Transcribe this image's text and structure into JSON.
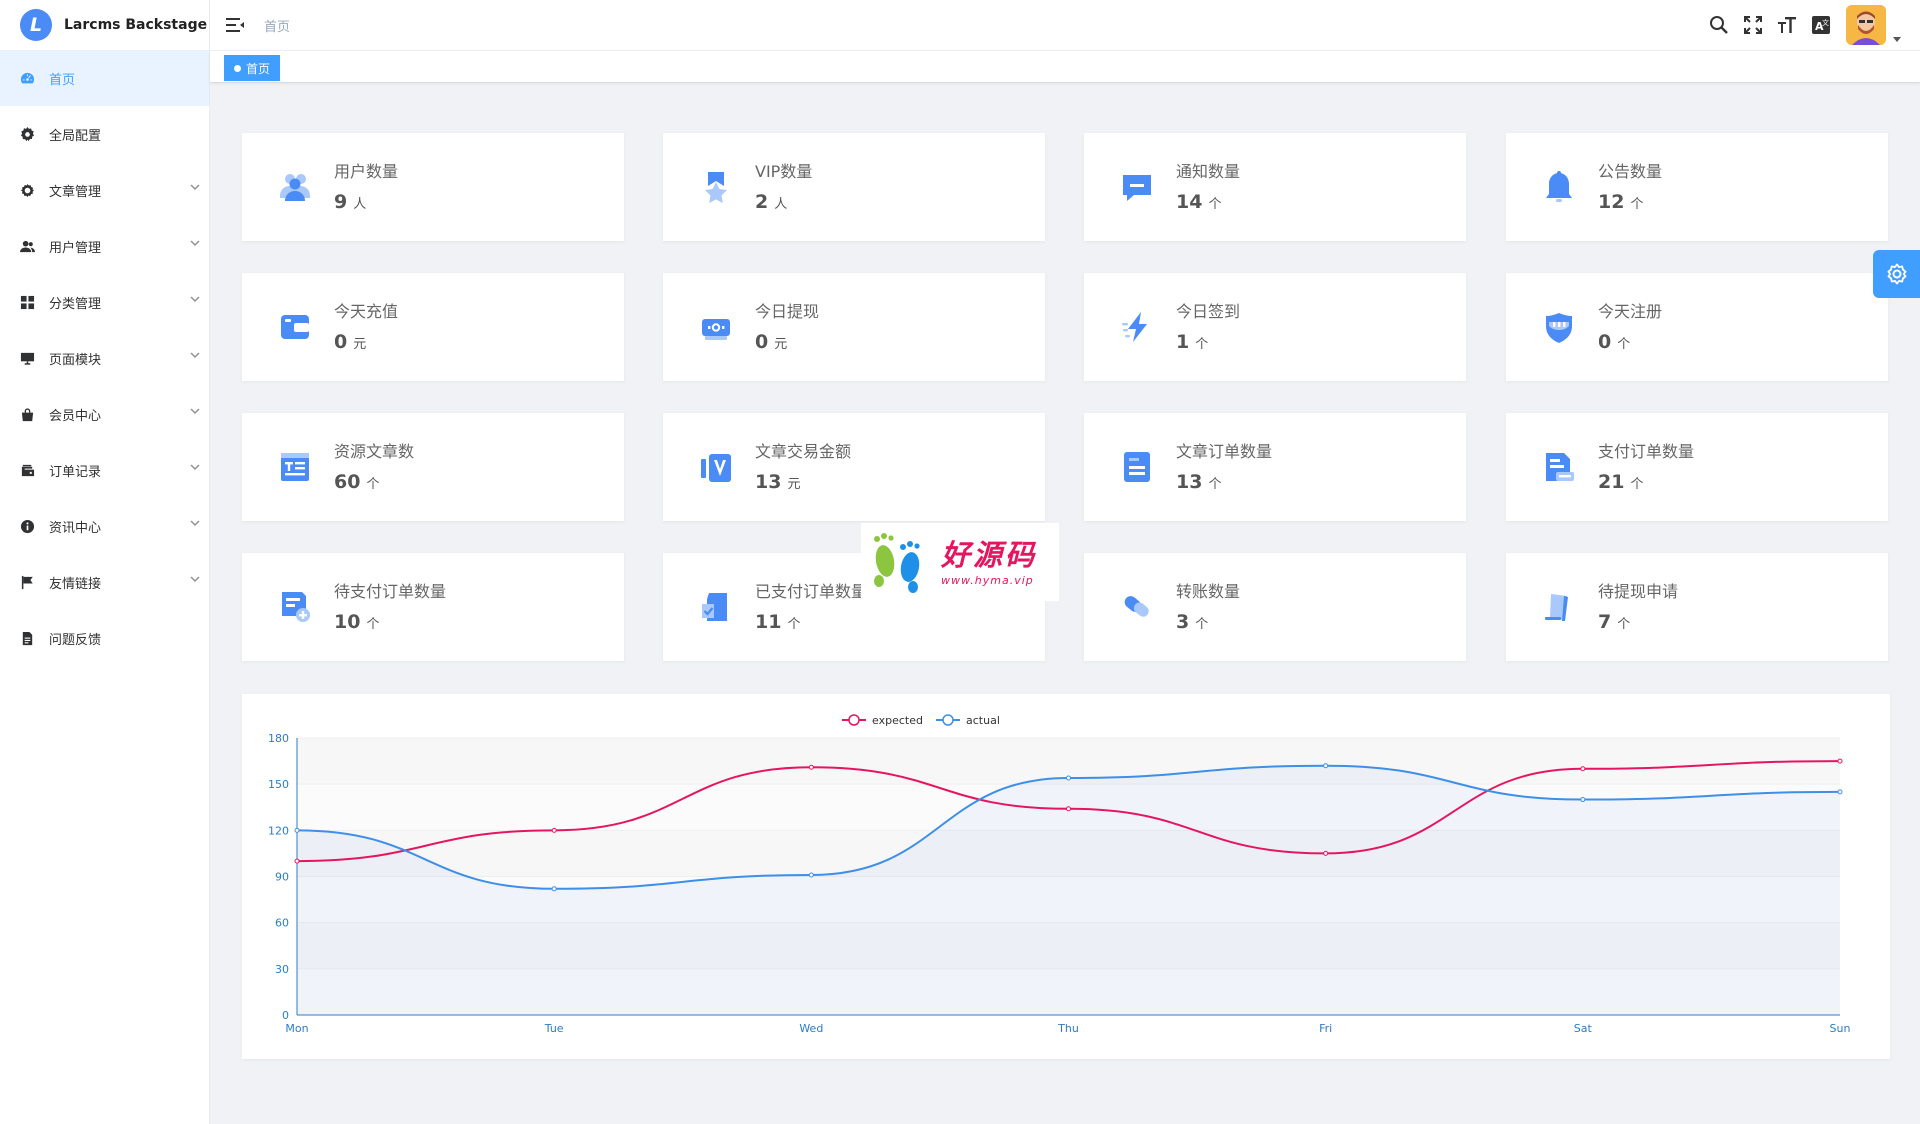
{
  "app": {
    "title": "Larcms Backstage",
    "logo_letter": "L"
  },
  "header": {
    "breadcrumb": "首页"
  },
  "tags": [
    {
      "label": "首页",
      "active": true
    }
  ],
  "sidebar": {
    "items": [
      {
        "label": "首页",
        "icon": "dashboard-icon",
        "active": true,
        "expandable": false
      },
      {
        "label": "全局配置",
        "icon": "gear-icon",
        "active": false,
        "expandable": false
      },
      {
        "label": "文章管理",
        "icon": "settings-ring-icon",
        "active": false,
        "expandable": true
      },
      {
        "label": "用户管理",
        "icon": "users-icon",
        "active": false,
        "expandable": true
      },
      {
        "label": "分类管理",
        "icon": "grid-icon",
        "active": false,
        "expandable": true
      },
      {
        "label": "页面模块",
        "icon": "monitor-icon",
        "active": false,
        "expandable": true
      },
      {
        "label": "会员中心",
        "icon": "bag-icon",
        "active": false,
        "expandable": true
      },
      {
        "label": "订单记录",
        "icon": "wallet-icon",
        "active": false,
        "expandable": true
      },
      {
        "label": "资讯中心",
        "icon": "info-icon",
        "active": false,
        "expandable": true
      },
      {
        "label": "友情链接",
        "icon": "flag-icon",
        "active": false,
        "expandable": true
      },
      {
        "label": "问题反馈",
        "icon": "document-icon",
        "active": false,
        "expandable": false
      }
    ]
  },
  "stats": [
    {
      "title": "用户数量",
      "value": "9",
      "unit": "人",
      "icon": "users-icon"
    },
    {
      "title": "VIP数量",
      "value": "2",
      "unit": "人",
      "icon": "vip-star-icon"
    },
    {
      "title": "通知数量",
      "value": "14",
      "unit": "个",
      "icon": "message-icon"
    },
    {
      "title": "公告数量",
      "value": "12",
      "unit": "个",
      "icon": "bell-icon"
    },
    {
      "title": "今天充值",
      "value": "0",
      "unit": "元",
      "icon": "wallet-icon"
    },
    {
      "title": "今日提现",
      "value": "0",
      "unit": "元",
      "icon": "cash-icon"
    },
    {
      "title": "今日签到",
      "value": "1",
      "unit": "个",
      "icon": "lightning-icon"
    },
    {
      "title": "今天注册",
      "value": "0",
      "unit": "个",
      "icon": "shield-icon"
    },
    {
      "title": "资源文章数",
      "value": "60",
      "unit": "个",
      "icon": "article-icon"
    },
    {
      "title": "文章交易金额",
      "value": "13",
      "unit": "元",
      "icon": "trade-icon"
    },
    {
      "title": "文章订单数量",
      "value": "13",
      "unit": "个",
      "icon": "order-icon"
    },
    {
      "title": "支付订单数量",
      "value": "21",
      "unit": "个",
      "icon": "payment-order-icon"
    },
    {
      "title": "待支付订单数量",
      "value": "10",
      "unit": "个",
      "icon": "pending-order-icon"
    },
    {
      "title": "已支付订单数量",
      "value": "11",
      "unit": "个",
      "icon": "paid-order-icon"
    },
    {
      "title": "转账数量",
      "value": "3",
      "unit": "个",
      "icon": "transfer-icon"
    },
    {
      "title": "待提现申请",
      "value": "7",
      "unit": "个",
      "icon": "withdraw-icon"
    }
  ],
  "colors": {
    "accent": "#409eff",
    "icon_blue": "#4a8bf5",
    "expected": "#e5155f",
    "actual": "#3d8fe8"
  },
  "chart_data": {
    "type": "line",
    "categories": [
      "Mon",
      "Tue",
      "Wed",
      "Thu",
      "Fri",
      "Sat",
      "Sun"
    ],
    "series": [
      {
        "name": "expected",
        "values": [
          100,
          120,
          161,
          134,
          105,
          160,
          165
        ]
      },
      {
        "name": "actual",
        "values": [
          120,
          82,
          91,
          154,
          162,
          140,
          145
        ]
      }
    ],
    "ylim": [
      0,
      180
    ],
    "yticks": [
      "0",
      "30",
      "60",
      "90",
      "120",
      "150",
      "180"
    ],
    "smooth": true,
    "area_fill_series": "actual",
    "legend": "top-center",
    "grid": true
  },
  "watermark": {
    "main": "好源码",
    "sub": "www.hyma.vip"
  }
}
